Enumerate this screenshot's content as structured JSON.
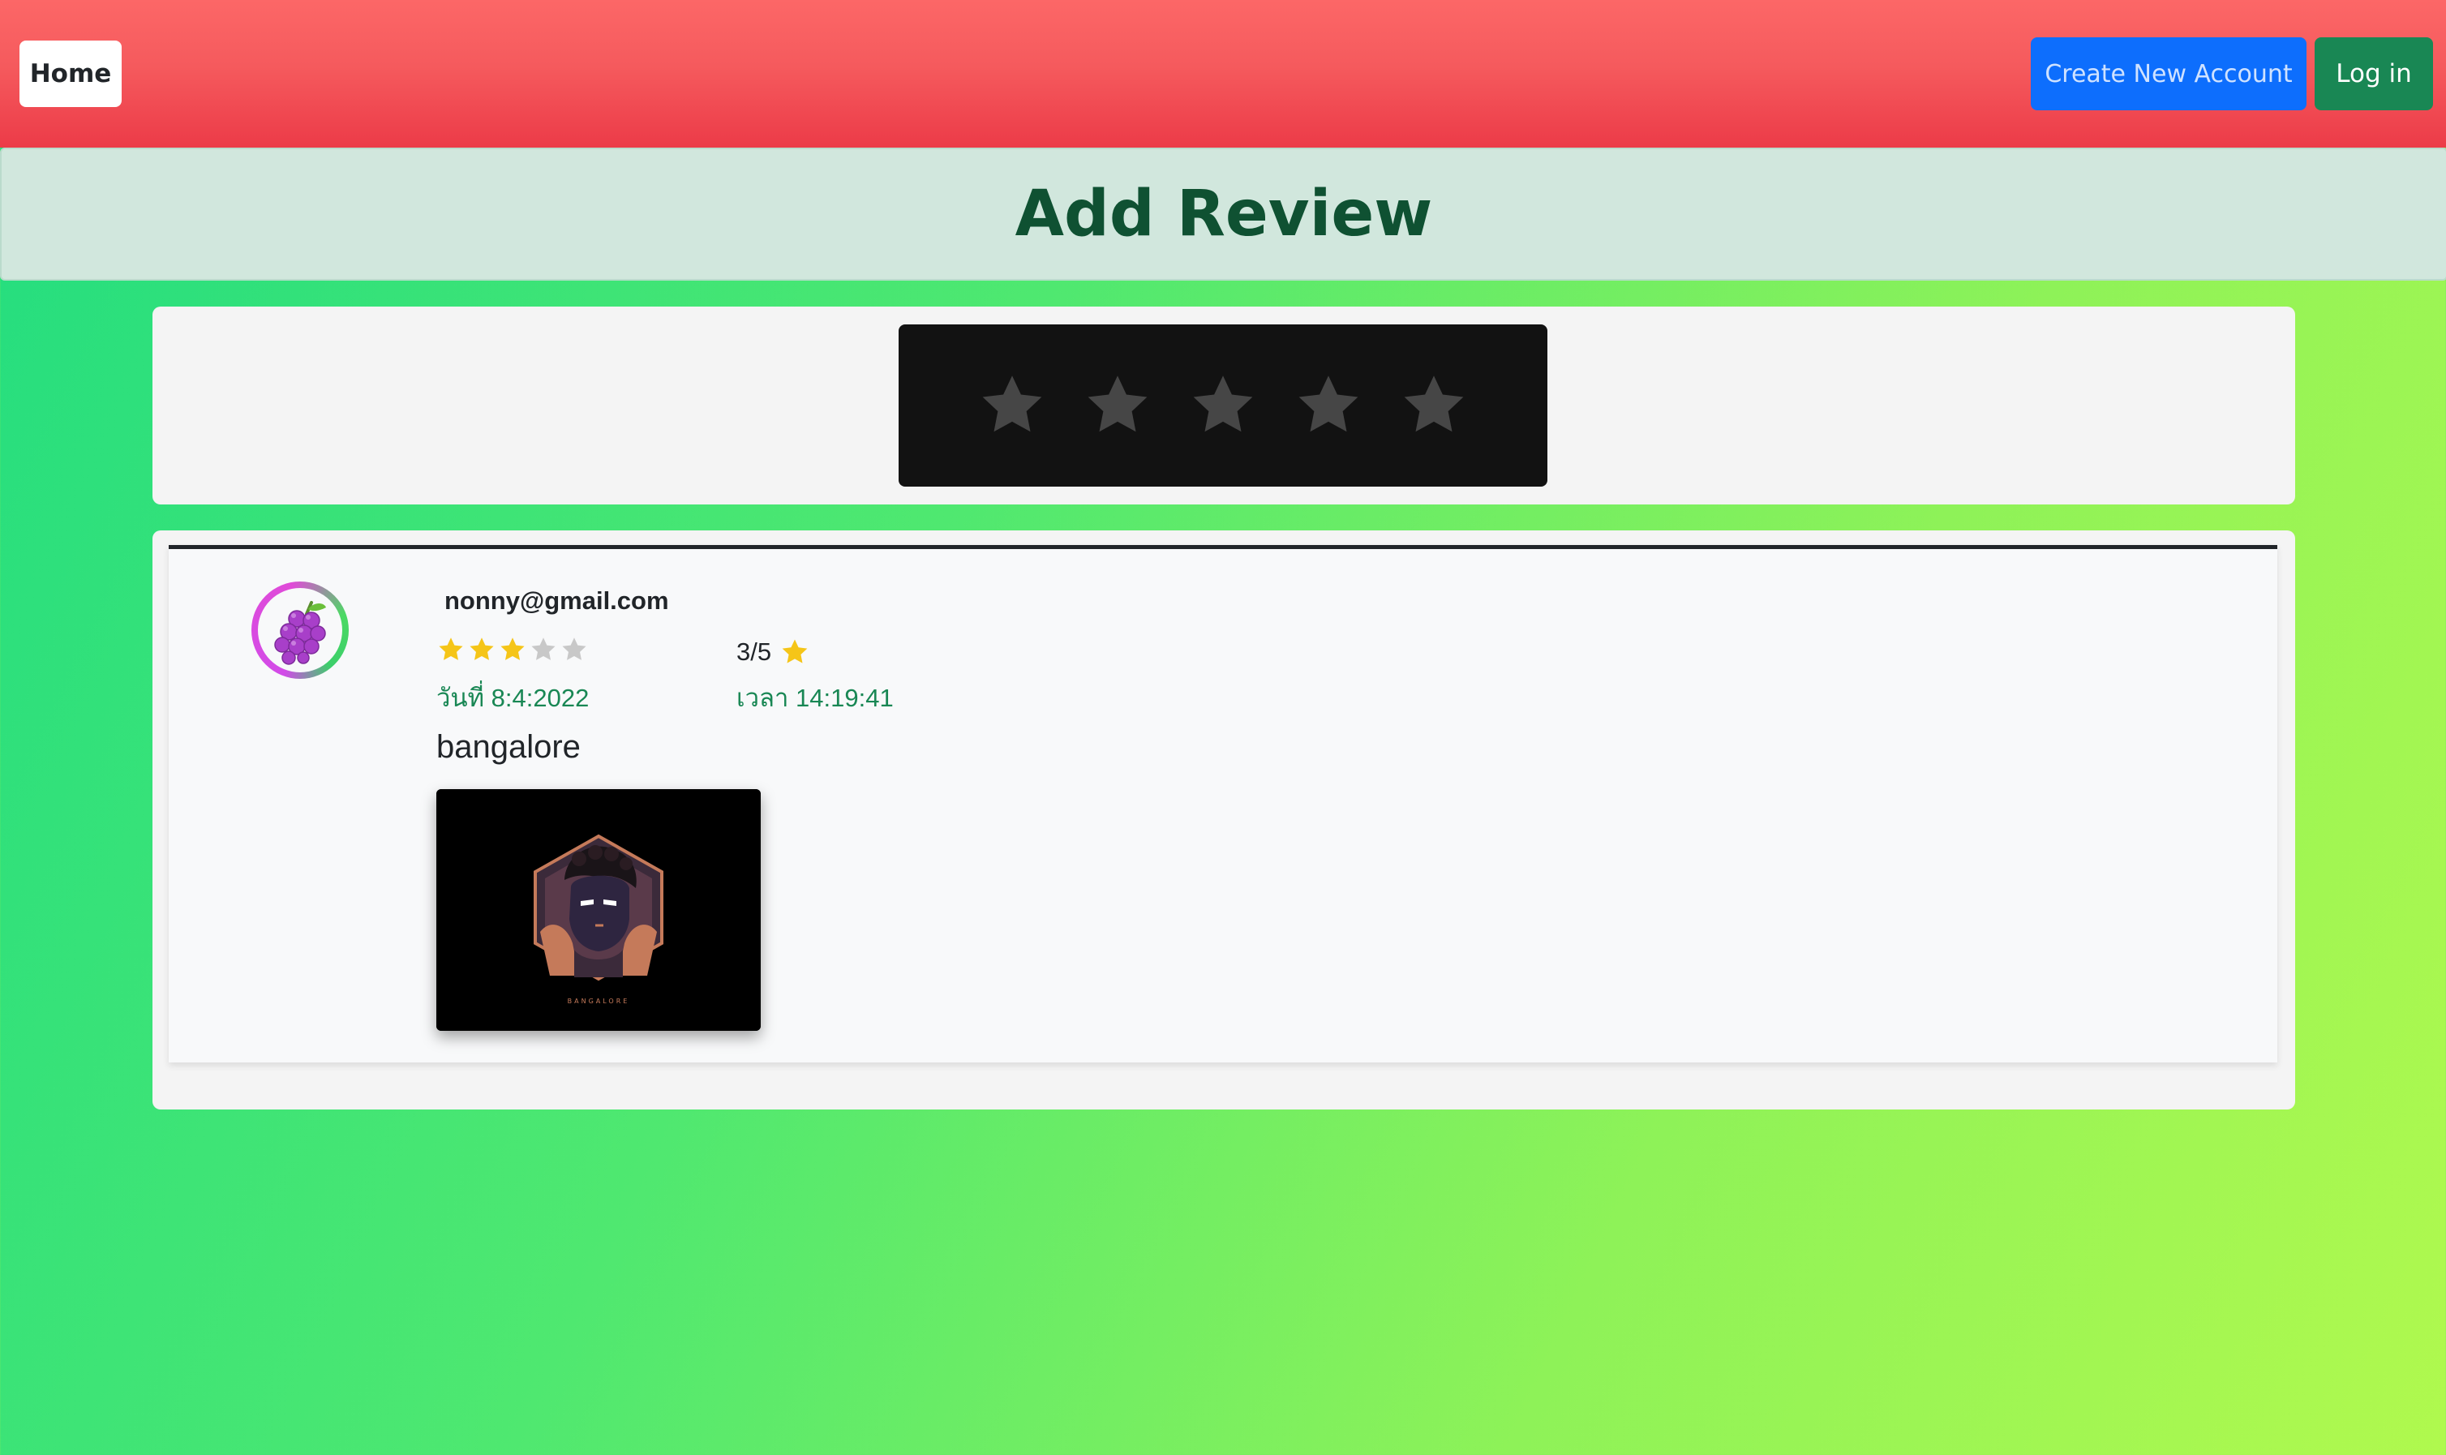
{
  "navbar": {
    "home_label": "Home",
    "create_account_label": "Create New Account",
    "login_label": "Log in"
  },
  "page": {
    "title": "Add Review"
  },
  "rating_input": {
    "max_stars": 5,
    "selected": 0,
    "star_icon": "star-icon",
    "colors": {
      "star_empty": "#464646",
      "box_bg": "#121212"
    }
  },
  "reviews": [
    {
      "email": "nonny@gmail.com",
      "avatar_icon": "grapes-icon",
      "rating": 3,
      "max_rating": 5,
      "score_text": "3/5",
      "date_text": "วันที่ 8:4:2022",
      "time_text": "เวลา 14:19:41",
      "body": "bangalore",
      "image_caption": "BANGALORE"
    }
  ],
  "colors": {
    "navbar_top": "#fc6767",
    "navbar_bottom": "#ec3b48",
    "title_bg": "#d1e7dd",
    "title_text": "#0f5132",
    "primary": "#0d6efd",
    "success": "#198754",
    "star_filled": "#f5c518",
    "star_gray": "#c8c8c8",
    "bg_gradient_start": "#22dd80",
    "bg_gradient_end": "#b0f94e"
  }
}
